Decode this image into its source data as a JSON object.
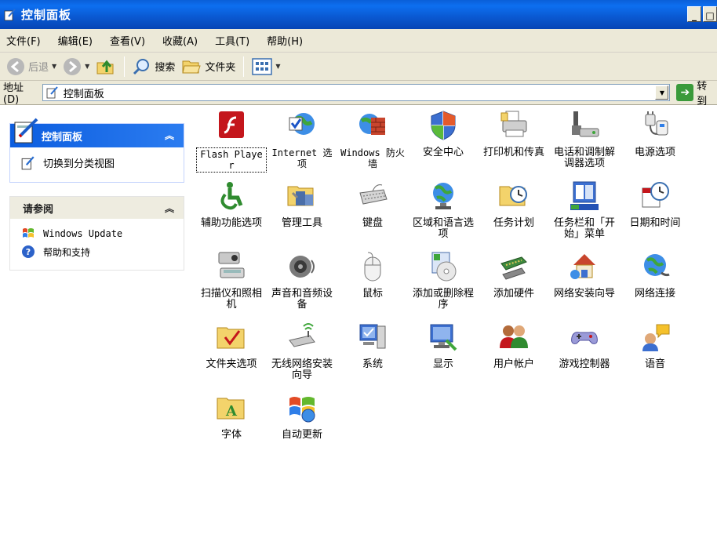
{
  "window": {
    "title": "控制面板"
  },
  "menu": [
    "文件(F)",
    "编辑(E)",
    "查看(V)",
    "收藏(A)",
    "工具(T)",
    "帮助(H)"
  ],
  "toolbar": {
    "back": "后退",
    "search": "搜索",
    "folders": "文件夹"
  },
  "address": {
    "label": "地址(D)",
    "value": "控制面板",
    "go": "转到"
  },
  "leftpane": {
    "panel_title": "控制面板",
    "switch_view": "切换到分类视图",
    "see_also_title": "请参阅",
    "see_also": [
      "Windows Update",
      "帮助和支持"
    ]
  },
  "items": [
    {
      "label": "Flash Player",
      "icon": "flash-icon"
    },
    {
      "label": "Internet 选项",
      "icon": "globe-check-icon"
    },
    {
      "label": "Windows 防火墙",
      "icon": "firewall-icon"
    },
    {
      "label": "安全中心",
      "icon": "shield-icon"
    },
    {
      "label": "打印机和传真",
      "icon": "printer-icon"
    },
    {
      "label": "电话和调制解调器选项",
      "icon": "phone-modem-icon"
    },
    {
      "label": "电源选项",
      "icon": "power-plug-icon"
    },
    {
      "label": "辅助功能选项",
      "icon": "accessibility-icon"
    },
    {
      "label": "管理工具",
      "icon": "admin-tools-icon"
    },
    {
      "label": "键盘",
      "icon": "keyboard-icon"
    },
    {
      "label": "区域和语言选项",
      "icon": "globe-clock-icon"
    },
    {
      "label": "任务计划",
      "icon": "scheduled-task-icon"
    },
    {
      "label": "任务栏和「开始」菜单",
      "icon": "taskbar-icon"
    },
    {
      "label": "日期和时间",
      "icon": "calendar-clock-icon"
    },
    {
      "label": "扫描仪和照相机",
      "icon": "scanner-camera-icon"
    },
    {
      "label": "声音和音频设备",
      "icon": "speaker-icon"
    },
    {
      "label": "鼠标",
      "icon": "mouse-icon"
    },
    {
      "label": "添加或删除程序",
      "icon": "add-remove-programs-icon"
    },
    {
      "label": "添加硬件",
      "icon": "add-hardware-icon"
    },
    {
      "label": "网络安装向导",
      "icon": "network-setup-wizard-icon"
    },
    {
      "label": "网络连接",
      "icon": "network-connections-icon"
    },
    {
      "label": "文件夹选项",
      "icon": "folder-options-icon"
    },
    {
      "label": "无线网络安装向导",
      "icon": "wireless-wizard-icon"
    },
    {
      "label": "系统",
      "icon": "system-icon"
    },
    {
      "label": "显示",
      "icon": "display-icon"
    },
    {
      "label": "用户帐户",
      "icon": "user-accounts-icon"
    },
    {
      "label": "游戏控制器",
      "icon": "game-controller-icon"
    },
    {
      "label": "语音",
      "icon": "speech-icon"
    },
    {
      "label": "字体",
      "icon": "fonts-icon"
    },
    {
      "label": "自动更新",
      "icon": "windows-update-icon"
    }
  ],
  "colors": {
    "titlebar": "#0a5fd8",
    "chrome": "#ece9d8",
    "panel_head": "#0c5ddf"
  }
}
